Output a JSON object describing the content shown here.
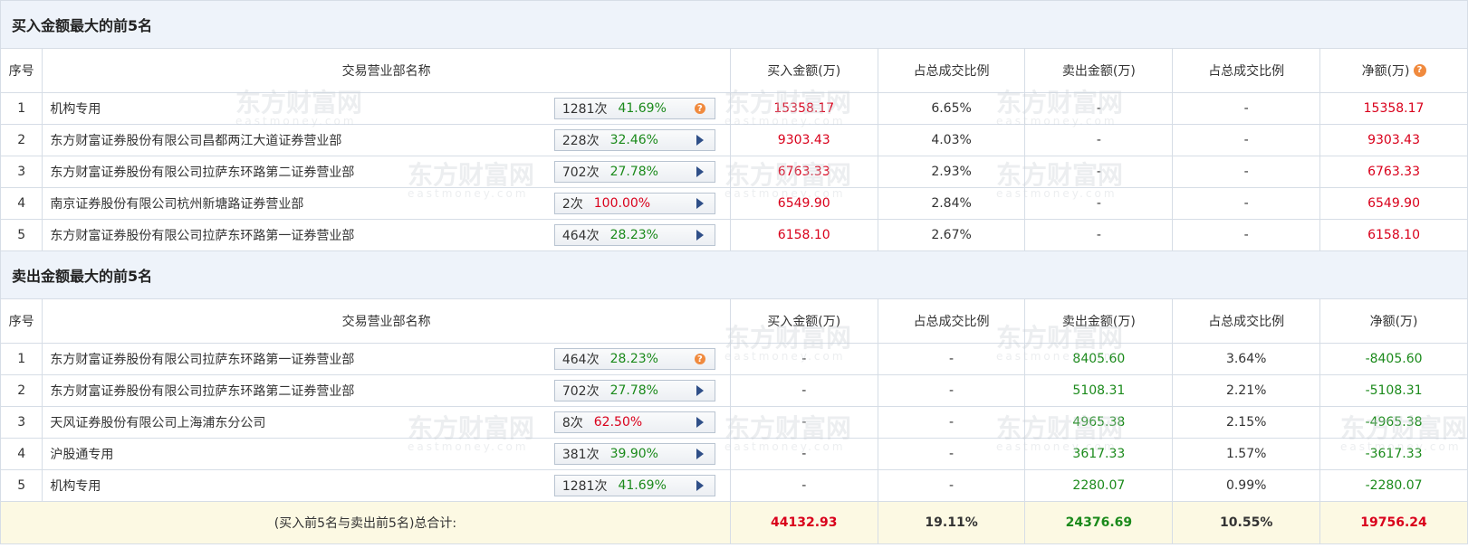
{
  "buy_section": {
    "title": "买入金额最大的前5名",
    "headers": [
      "序号",
      "交易营业部名称",
      "买入金额(万)",
      "占总成交比例",
      "卖出金额(万)",
      "占总成交比例",
      "净额(万)"
    ],
    "rows": [
      {
        "idx": "1",
        "name": "机构专用",
        "times": "1281次",
        "pct": "41.69%",
        "pct_color": "green",
        "ctl": "question",
        "buy": "15358.17",
        "buy_ratio": "6.65%",
        "sell": "-",
        "sell_ratio": "-",
        "net": "15358.17"
      },
      {
        "idx": "2",
        "name": "东方财富证券股份有限公司昌都两江大道证券营业部",
        "times": "228次",
        "pct": "32.46%",
        "pct_color": "green",
        "ctl": "arrow",
        "buy": "9303.43",
        "buy_ratio": "4.03%",
        "sell": "-",
        "sell_ratio": "-",
        "net": "9303.43"
      },
      {
        "idx": "3",
        "name": "东方财富证券股份有限公司拉萨东环路第二证券营业部",
        "times": "702次",
        "pct": "27.78%",
        "pct_color": "green",
        "ctl": "arrow",
        "buy": "6763.33",
        "buy_ratio": "2.93%",
        "sell": "-",
        "sell_ratio": "-",
        "net": "6763.33"
      },
      {
        "idx": "4",
        "name": "南京证券股份有限公司杭州新塘路证券营业部",
        "times": "2次",
        "pct": "100.00%",
        "pct_color": "red",
        "ctl": "arrow",
        "buy": "6549.90",
        "buy_ratio": "2.84%",
        "sell": "-",
        "sell_ratio": "-",
        "net": "6549.90"
      },
      {
        "idx": "5",
        "name": "东方财富证券股份有限公司拉萨东环路第一证券营业部",
        "times": "464次",
        "pct": "28.23%",
        "pct_color": "green",
        "ctl": "arrow",
        "buy": "6158.10",
        "buy_ratio": "2.67%",
        "sell": "-",
        "sell_ratio": "-",
        "net": "6158.10"
      }
    ]
  },
  "sell_section": {
    "title": "卖出金额最大的前5名",
    "headers": [
      "序号",
      "交易营业部名称",
      "买入金额(万)",
      "占总成交比例",
      "卖出金额(万)",
      "占总成交比例",
      "净额(万)"
    ],
    "rows": [
      {
        "idx": "1",
        "name": "东方财富证券股份有限公司拉萨东环路第一证券营业部",
        "times": "464次",
        "pct": "28.23%",
        "pct_color": "green",
        "ctl": "question",
        "buy": "-",
        "buy_ratio": "-",
        "sell": "8405.60",
        "sell_ratio": "3.64%",
        "net": "-8405.60"
      },
      {
        "idx": "2",
        "name": "东方财富证券股份有限公司拉萨东环路第二证券营业部",
        "times": "702次",
        "pct": "27.78%",
        "pct_color": "green",
        "ctl": "arrow",
        "buy": "-",
        "buy_ratio": "-",
        "sell": "5108.31",
        "sell_ratio": "2.21%",
        "net": "-5108.31"
      },
      {
        "idx": "3",
        "name": "天风证券股份有限公司上海浦东分公司",
        "times": "8次",
        "pct": "62.50%",
        "pct_color": "red",
        "ctl": "arrow",
        "buy": "-",
        "buy_ratio": "-",
        "sell": "4965.38",
        "sell_ratio": "2.15%",
        "net": "-4965.38"
      },
      {
        "idx": "4",
        "name": "沪股通专用",
        "times": "381次",
        "pct": "39.90%",
        "pct_color": "green",
        "ctl": "arrow",
        "buy": "-",
        "buy_ratio": "-",
        "sell": "3617.33",
        "sell_ratio": "1.57%",
        "net": "-3617.33"
      },
      {
        "idx": "5",
        "name": "机构专用",
        "times": "1281次",
        "pct": "41.69%",
        "pct_color": "green",
        "ctl": "arrow",
        "buy": "-",
        "buy_ratio": "-",
        "sell": "2280.07",
        "sell_ratio": "0.99%",
        "net": "-2280.07"
      }
    ]
  },
  "summary": {
    "label": "(买入前5名与卖出前5名)总合计:",
    "buy_total": "44132.93",
    "buy_ratio": "19.11%",
    "sell_total": "24376.69",
    "sell_ratio": "10.55%",
    "net_total": "19756.24"
  },
  "watermark": {
    "brand": "东方财富网",
    "domain": "eastmoney.com"
  },
  "colors": {
    "red": "#d9001b",
    "green": "#1b8a1b",
    "header_bg": "#eef3fa",
    "summary_bg": "#fcf9e3",
    "icon_orange": "#f08a3e",
    "arrow_blue": "#2f4f88"
  },
  "icons": {
    "question": "question-icon",
    "arrow": "arrow-right-icon"
  }
}
